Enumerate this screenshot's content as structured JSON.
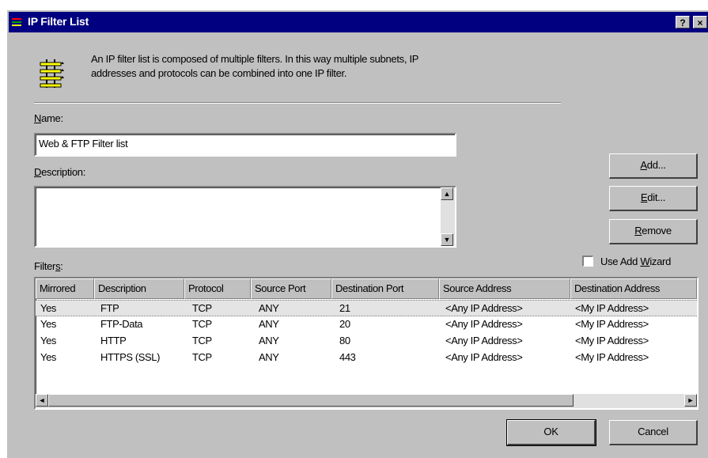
{
  "window": {
    "title": "IP Filter List",
    "help_label": "?",
    "close_label": "×"
  },
  "info": {
    "text_line1": "An IP filter list is composed of multiple filters. In this way multiple subnets, IP",
    "text_line2": "addresses and protocols can be combined into one IP filter."
  },
  "name": {
    "label_accel": "N",
    "label_rest": "ame:",
    "value": "Web & FTP Filter list"
  },
  "description": {
    "label_accel": "D",
    "label_rest": "escription:",
    "value": ""
  },
  "buttons": {
    "add": {
      "accel": "A",
      "rest": "dd..."
    },
    "edit": {
      "accel": "E",
      "rest": "dit..."
    },
    "remove": {
      "accel": "R",
      "rest": "emove"
    },
    "ok": "OK",
    "cancel": "Cancel"
  },
  "wizard": {
    "label_pre": "Use Add ",
    "label_accel": "W",
    "label_post": "izard",
    "checked": false
  },
  "filters": {
    "label_pre": "Filter",
    "label_accel": "s",
    "label_post": ":",
    "columns": [
      "Mirrored",
      "Description",
      "Protocol",
      "Source Port",
      "Destination Port",
      "Source Address",
      "Destination Address"
    ],
    "rows": [
      [
        "Yes",
        "FTP",
        "TCP",
        "ANY",
        "21",
        "<Any IP Address>",
        "<My IP Address>"
      ],
      [
        "Yes",
        "FTP-Data",
        "TCP",
        "ANY",
        "20",
        "<Any IP Address>",
        "<My IP Address>"
      ],
      [
        "Yes",
        "HTTP",
        "TCP",
        "ANY",
        "80",
        "<Any IP Address>",
        "<My IP Address>"
      ],
      [
        "Yes",
        "HTTPS (SSL)",
        "TCP",
        "ANY",
        "443",
        "<Any IP Address>",
        "<My IP Address>"
      ]
    ],
    "selected_row": 0
  },
  "colors": {
    "titlebar": "#000080",
    "face": "#c0c0c0",
    "icon_accent": "#ffff00"
  }
}
